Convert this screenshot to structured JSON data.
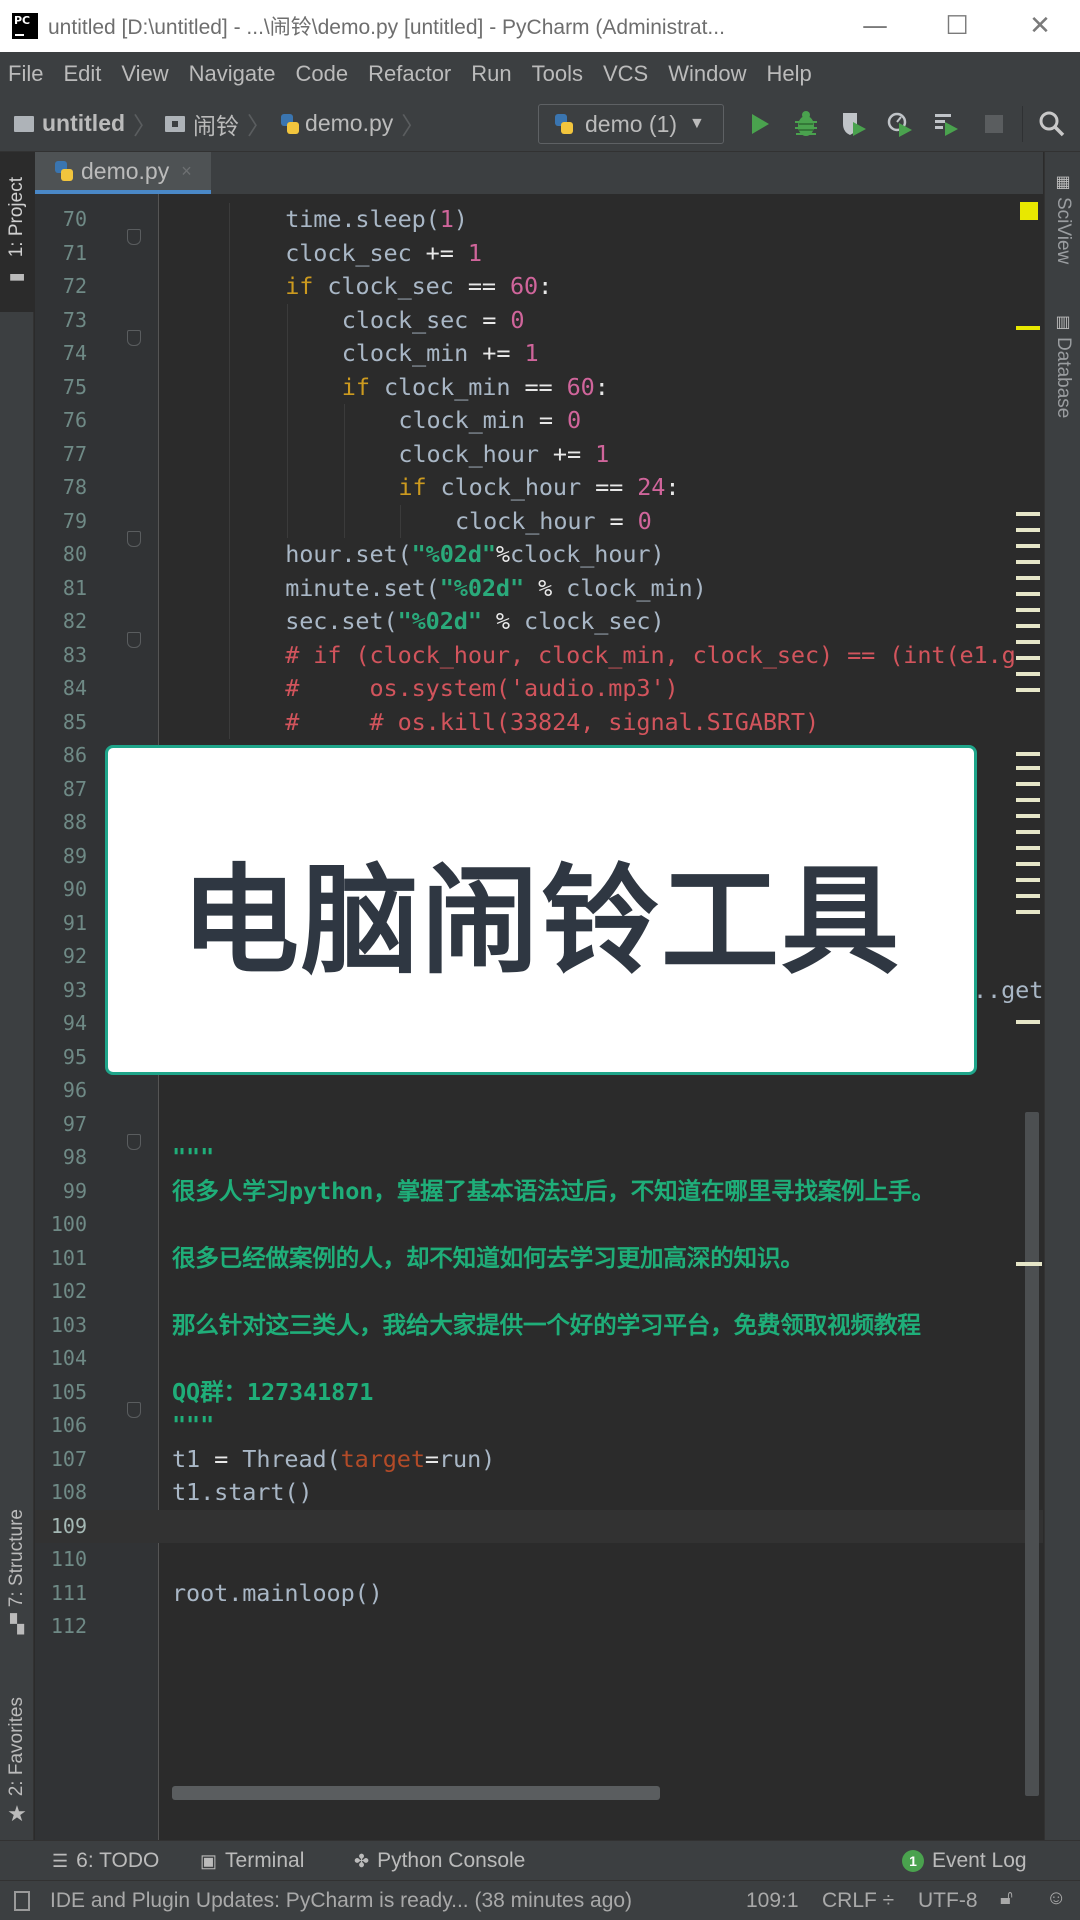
{
  "window": {
    "title": "untitled [D:\\untitled] - ...\\闹铃\\demo.py [untitled] - PyCharm (Administrat...",
    "app_logo": "PC",
    "minimize_icon": "—",
    "maximize_icon": "☐",
    "close_icon": "✕"
  },
  "menu": {
    "items": [
      "File",
      "Edit",
      "View",
      "Navigate",
      "Code",
      "Refactor",
      "Run",
      "Tools",
      "VCS",
      "Window",
      "Help"
    ]
  },
  "breadcrumb": {
    "project": "untitled",
    "folder": "闹铃",
    "file": "demo.py",
    "separator": "〉"
  },
  "toolbar": {
    "run_config": "demo (1)",
    "caret": "▼",
    "icons": [
      "run-icon",
      "debug-icon",
      "coverage-icon",
      "profile-icon",
      "concurrency-icon",
      "stop-icon",
      "search-icon"
    ]
  },
  "left_tools": {
    "project": "1: Project",
    "structure": "7: Structure",
    "favorites": "2: Favorites"
  },
  "right_tools": {
    "sciview": "SciView",
    "database": "Database"
  },
  "editor": {
    "tab_label": "demo.py",
    "tab_close": "×",
    "current_line": 109,
    "lines": [
      {
        "n": "70",
        "indent": 8,
        "tokens": [
          [
            "",
            "time.sleep("
          ],
          [
            "num",
            "1"
          ],
          [
            "",
            ")"
          ]
        ]
      },
      {
        "n": "71",
        "indent": 8,
        "tokens": [
          [
            "",
            "clock_sec "
          ],
          [
            "op",
            "+="
          ],
          [
            "num",
            " 1"
          ]
        ]
      },
      {
        "n": "72",
        "indent": 8,
        "tokens": [
          [
            "kw",
            "if"
          ],
          [
            "",
            " clock_sec "
          ],
          [
            "op",
            "=="
          ],
          [
            "num",
            " 60"
          ],
          [
            "op",
            ":"
          ]
        ]
      },
      {
        "n": "73",
        "indent": 12,
        "tokens": [
          [
            "",
            "clock_sec "
          ],
          [
            "op",
            "="
          ],
          [
            "num",
            " 0"
          ]
        ]
      },
      {
        "n": "74",
        "indent": 12,
        "tokens": [
          [
            "",
            "clock_min "
          ],
          [
            "op",
            "+="
          ],
          [
            "num",
            " 1"
          ]
        ]
      },
      {
        "n": "75",
        "indent": 12,
        "tokens": [
          [
            "kw",
            "if"
          ],
          [
            "",
            " clock_min "
          ],
          [
            "op",
            "=="
          ],
          [
            "num",
            " 60"
          ],
          [
            "op",
            ":"
          ]
        ]
      },
      {
        "n": "76",
        "indent": 16,
        "tokens": [
          [
            "",
            "clock_min "
          ],
          [
            "op",
            "="
          ],
          [
            "num",
            " 0"
          ]
        ]
      },
      {
        "n": "77",
        "indent": 16,
        "tokens": [
          [
            "",
            "clock_hour "
          ],
          [
            "op",
            "+="
          ],
          [
            "num",
            " 1"
          ]
        ]
      },
      {
        "n": "78",
        "indent": 16,
        "tokens": [
          [
            "kw",
            "if"
          ],
          [
            "",
            " clock_hour "
          ],
          [
            "op",
            "=="
          ],
          [
            "num",
            " 24"
          ],
          [
            "op",
            ":"
          ]
        ]
      },
      {
        "n": "79",
        "indent": 20,
        "tokens": [
          [
            "",
            "clock_hour "
          ],
          [
            "op",
            "="
          ],
          [
            "num",
            " 0"
          ]
        ]
      },
      {
        "n": "80",
        "indent": 8,
        "tokens": [
          [
            "",
            "hour.set("
          ],
          [
            "str",
            "\"%02d\""
          ],
          [
            "op",
            "%"
          ],
          [
            "",
            "clock_hour)"
          ]
        ]
      },
      {
        "n": "81",
        "indent": 8,
        "tokens": [
          [
            "",
            "minute.set("
          ],
          [
            "str",
            "\"%02d\""
          ],
          [
            "op",
            " % "
          ],
          [
            "",
            "clock_min)"
          ]
        ]
      },
      {
        "n": "82",
        "indent": 8,
        "tokens": [
          [
            "",
            "sec.set("
          ],
          [
            "str",
            "\"%02d\""
          ],
          [
            "op",
            " % "
          ],
          [
            "",
            "clock_sec)"
          ]
        ]
      },
      {
        "n": "83",
        "indent": 8,
        "tokens": [
          [
            "cmt",
            "# if (clock_hour, clock_min, clock_sec) == (int(e1.g"
          ]
        ]
      },
      {
        "n": "84",
        "indent": 8,
        "tokens": [
          [
            "cmt",
            "#     os.system('audio.mp3')"
          ]
        ]
      },
      {
        "n": "85",
        "indent": 8,
        "tokens": [
          [
            "cmt",
            "#     # os.kill(33824, signal.SIGABRT)"
          ]
        ]
      },
      {
        "n": "86",
        "indent": 0,
        "tokens": []
      },
      {
        "n": "87",
        "indent": 0,
        "tokens": []
      },
      {
        "n": "88",
        "indent": 0,
        "tokens": []
      },
      {
        "n": "89",
        "indent": 0,
        "tokens": []
      },
      {
        "n": "90",
        "indent": 0,
        "tokens": []
      },
      {
        "n": "91",
        "indent": 0,
        "tokens": []
      },
      {
        "n": "92",
        "indent": 0,
        "tokens": []
      },
      {
        "n": "93",
        "indent": 0,
        "tokens": [],
        "tail": "..get"
      },
      {
        "n": "94",
        "indent": 0,
        "tokens": []
      },
      {
        "n": "95",
        "indent": 0,
        "tokens": []
      },
      {
        "n": "96",
        "indent": 0,
        "tokens": []
      },
      {
        "n": "97",
        "indent": 0,
        "tokens": []
      },
      {
        "n": "98",
        "indent": 0,
        "tokens": [
          [
            "doc",
            "\"\"\""
          ]
        ]
      },
      {
        "n": "99",
        "indent": 0,
        "tokens": [
          [
            "doc",
            "很多人学习python，掌握了基本语法过后，不知道在哪里寻找案例上手。"
          ]
        ]
      },
      {
        "n": "100",
        "indent": 0,
        "tokens": []
      },
      {
        "n": "101",
        "indent": 0,
        "tokens": [
          [
            "doc",
            "很多已经做案例的人，却不知道如何去学习更加高深的知识。"
          ]
        ]
      },
      {
        "n": "102",
        "indent": 0,
        "tokens": []
      },
      {
        "n": "103",
        "indent": 0,
        "tokens": [
          [
            "doc",
            "那么针对这三类人，我给大家提供一个好的学习平台，免费领取视频教程"
          ]
        ]
      },
      {
        "n": "104",
        "indent": 0,
        "tokens": []
      },
      {
        "n": "105",
        "indent": 0,
        "tokens": [
          [
            "doc",
            "QQ群：127341871"
          ]
        ]
      },
      {
        "n": "106",
        "indent": 0,
        "tokens": [
          [
            "doc",
            "\"\"\""
          ]
        ]
      },
      {
        "n": "107",
        "indent": 0,
        "tokens": [
          [
            "",
            "t1 "
          ],
          [
            "op",
            "="
          ],
          [
            "",
            " Thread("
          ],
          [
            "param",
            "target"
          ],
          [
            "op",
            "="
          ],
          [
            "",
            "run)"
          ]
        ]
      },
      {
        "n": "108",
        "indent": 0,
        "tokens": [
          [
            "",
            "t1.start()"
          ]
        ]
      },
      {
        "n": "109",
        "indent": 0,
        "tokens": []
      },
      {
        "n": "110",
        "indent": 0,
        "tokens": []
      },
      {
        "n": "111",
        "indent": 0,
        "tokens": [
          [
            "",
            "root.mainloop()"
          ]
        ]
      },
      {
        "n": "112",
        "indent": 0,
        "tokens": []
      }
    ]
  },
  "overlay": {
    "title": "电脑闹铃工具",
    "border_color": "#1fa58a"
  },
  "bottom_tools": {
    "todo": "6: TODO",
    "terminal": "Terminal",
    "python_console": "Python Console",
    "event_log": "Event Log",
    "event_count": "1"
  },
  "status": {
    "message": "IDE and Plugin Updates: PyCharm is ready... (38 minutes ago)",
    "position": "109:1",
    "line_sep": "CRLF ÷",
    "encoding": "UTF-8"
  },
  "colors": {
    "keyword": "#cc9a1f",
    "number": "#d0659b",
    "string": "#2aa97a",
    "comment": "#d2545c",
    "docstring": "#1fae79",
    "run_green": "#4aa24e"
  }
}
